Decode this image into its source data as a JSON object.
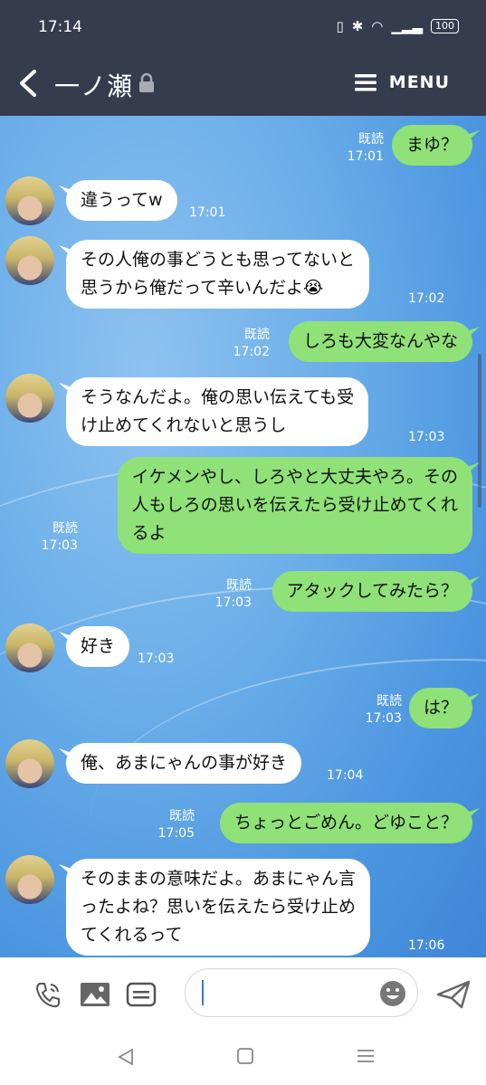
{
  "status_bar": {
    "time": "17:14",
    "battery": "100"
  },
  "header": {
    "title": "一ノ瀬",
    "menu_label": "MENU"
  },
  "read_label": "既読",
  "messages": [
    {
      "side": "out",
      "text": "まゆ？",
      "time": "17:01",
      "read": true
    },
    {
      "side": "in",
      "text": "違うってw",
      "time": "17:01"
    },
    {
      "side": "in",
      "text": "その人俺の事どうとも思ってないと\n思うから俺だって辛いんだよ😭",
      "time": "17:02"
    },
    {
      "side": "out",
      "text": "しろも大変なんやな",
      "time": "17:02",
      "read": true
    },
    {
      "side": "in",
      "text": "そうなんだよ。俺の思い伝えても受\nけ止めてくれないと思うし",
      "time": "17:03"
    },
    {
      "side": "out",
      "text": "イケメンやし、しろやと大丈夫やろ。その\n人もしろの思いを伝えたら受け止めてくれ\nるよ",
      "time": "17:03",
      "read": true
    },
    {
      "side": "out",
      "text": "アタックしてみたら？",
      "time": "17:03",
      "read": true
    },
    {
      "side": "in",
      "text": "好き",
      "time": "17:03"
    },
    {
      "side": "out",
      "text": "は？",
      "time": "17:03",
      "read": true
    },
    {
      "side": "in",
      "text": "俺、あまにゃんの事が好き",
      "time": "17:04"
    },
    {
      "side": "out",
      "text": "ちょっとごめん。どゆこと？",
      "time": "17:05",
      "read": true
    },
    {
      "side": "in",
      "text": "そのままの意味だよ。あまにゃん言\nったよね？思いを伝えたら受け止め\nてくれるって",
      "time": "17:06"
    }
  ],
  "toolbar": {
    "icons": [
      "phone-icon",
      "image-icon",
      "sticker-list-icon",
      "emoji-icon",
      "send-icon"
    ],
    "input_value": ""
  },
  "colors": {
    "header_bg": "#353c4e",
    "bubble_out": "#8fe178",
    "bubble_in": "#ffffff"
  }
}
